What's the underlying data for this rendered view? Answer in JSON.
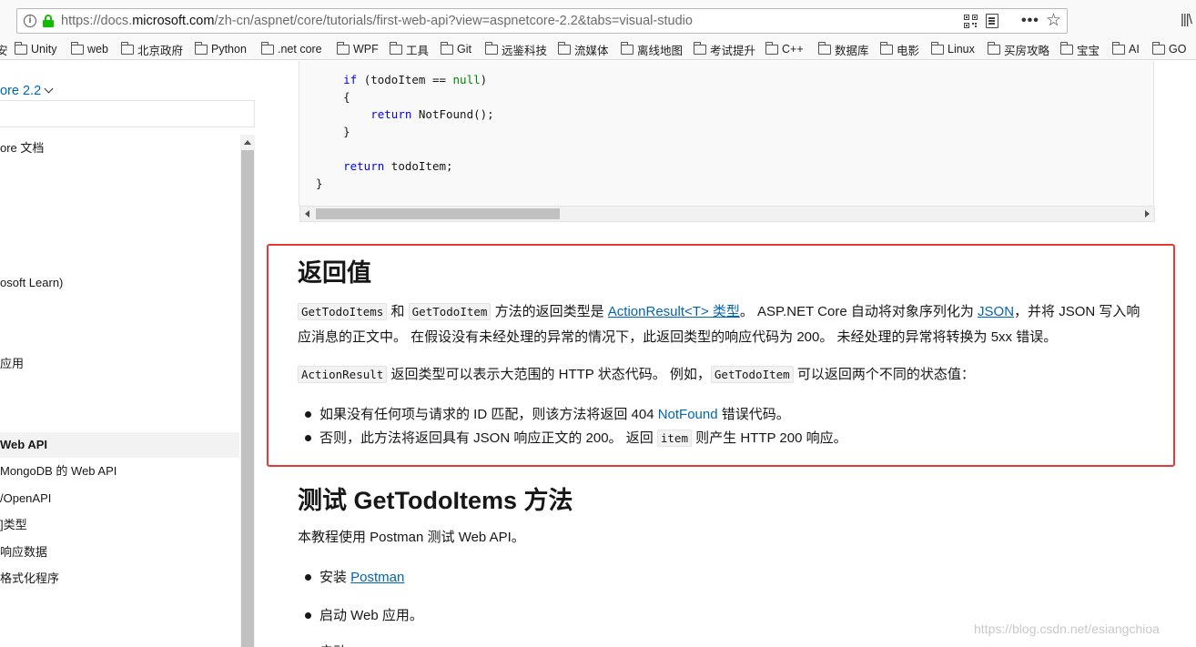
{
  "browser": {
    "url_prefix": "https://docs.",
    "url_domain": "microsoft.com",
    "url_rest": "/zh-cn/aspnet/core/tutorials/first-web-api?view=aspnetcore-2.2&tabs=visual-studio",
    "more_glyph": "•••",
    "star_glyph": "☆",
    "library_glyph": "|||\\"
  },
  "bookmarks": [
    "Unity",
    "web",
    "北京政府",
    "Python",
    ".net core",
    "WPF",
    "工具",
    "Git",
    "远鉴科技",
    "流媒体",
    "离线地图",
    "考试提升",
    "C++",
    "数据库",
    "电影",
    "Linux",
    "买房攻略",
    "宝宝",
    "AI",
    "GO"
  ],
  "bookmarks_leading_fragment": "安",
  "sidebar": {
    "version_label": "ore 2.2",
    "items": [
      {
        "label": "ore 文档"
      },
      {
        "label": "osoft Learn)"
      },
      {
        "label": "应用"
      },
      {
        "label": "Web API"
      },
      {
        "label": "MongoDB 的 Web API"
      },
      {
        "label": "/OpenAPI"
      },
      {
        "label": "]类型"
      },
      {
        "label": "响应数据"
      },
      {
        "label": "格式化程序"
      }
    ]
  },
  "code": {
    "line1_kw": "if",
    "line1_rest_a": " (todoItem == ",
    "line1_null": "null",
    "line1_rest_b": ")",
    "line2": "{",
    "line3_kw": "return",
    "line3_rest": " NotFound();",
    "line4": "}",
    "line5_kw": "return",
    "line5_rest": " todoItem;",
    "line6": "}"
  },
  "section1": {
    "heading": "返回值",
    "p1_code1": "GetTodoItems",
    "p1_t1": " 和 ",
    "p1_code2": "GetTodoItem",
    "p1_t2": " 方法的返回类型是 ",
    "p1_link1": "ActionResult<T> 类型",
    "p1_t3": "。 ASP.NET Core 自动将对象序列化为 ",
    "p1_link2": "JSON",
    "p1_t4": "，并将 JSON 写入响应消息的正文中。 在假设没有未经处理的异常的情况下，此返回类型的响应代码为 200。 未经处理的异常将转换为 5xx 错误。",
    "p2_code1": "ActionResult",
    "p2_t1": " 返回类型可以表示大范围的 HTTP 状态代码。 例如，",
    "p2_code2": "GetTodoItem",
    "p2_t2": " 可以返回两个不同的状态值：",
    "b1_t1": "如果没有任何项与请求的 ID 匹配，则该方法将返回 404 ",
    "b1_link": "NotFound",
    "b1_t2": " 错误代码。",
    "b2_t1": "否则，此方法将返回具有 JSON 响应正文的 200。 返回 ",
    "b2_code": "item",
    "b2_t2": " 则产生 HTTP 200 响应。"
  },
  "section2": {
    "heading": "测试 GetTodoItems 方法",
    "intro": "本教程使用 Postman 测试 Web API。",
    "b1_t1": "安装 ",
    "b1_link": "Postman",
    "b2": "启动 Web 应用。",
    "b3_partial": "启动"
  },
  "watermark": "https://blog.csdn.net/esiangchioa",
  "colors": {
    "link": "#0065b3",
    "highlight_border": "#e53935",
    "keyword": "#0101fd"
  }
}
